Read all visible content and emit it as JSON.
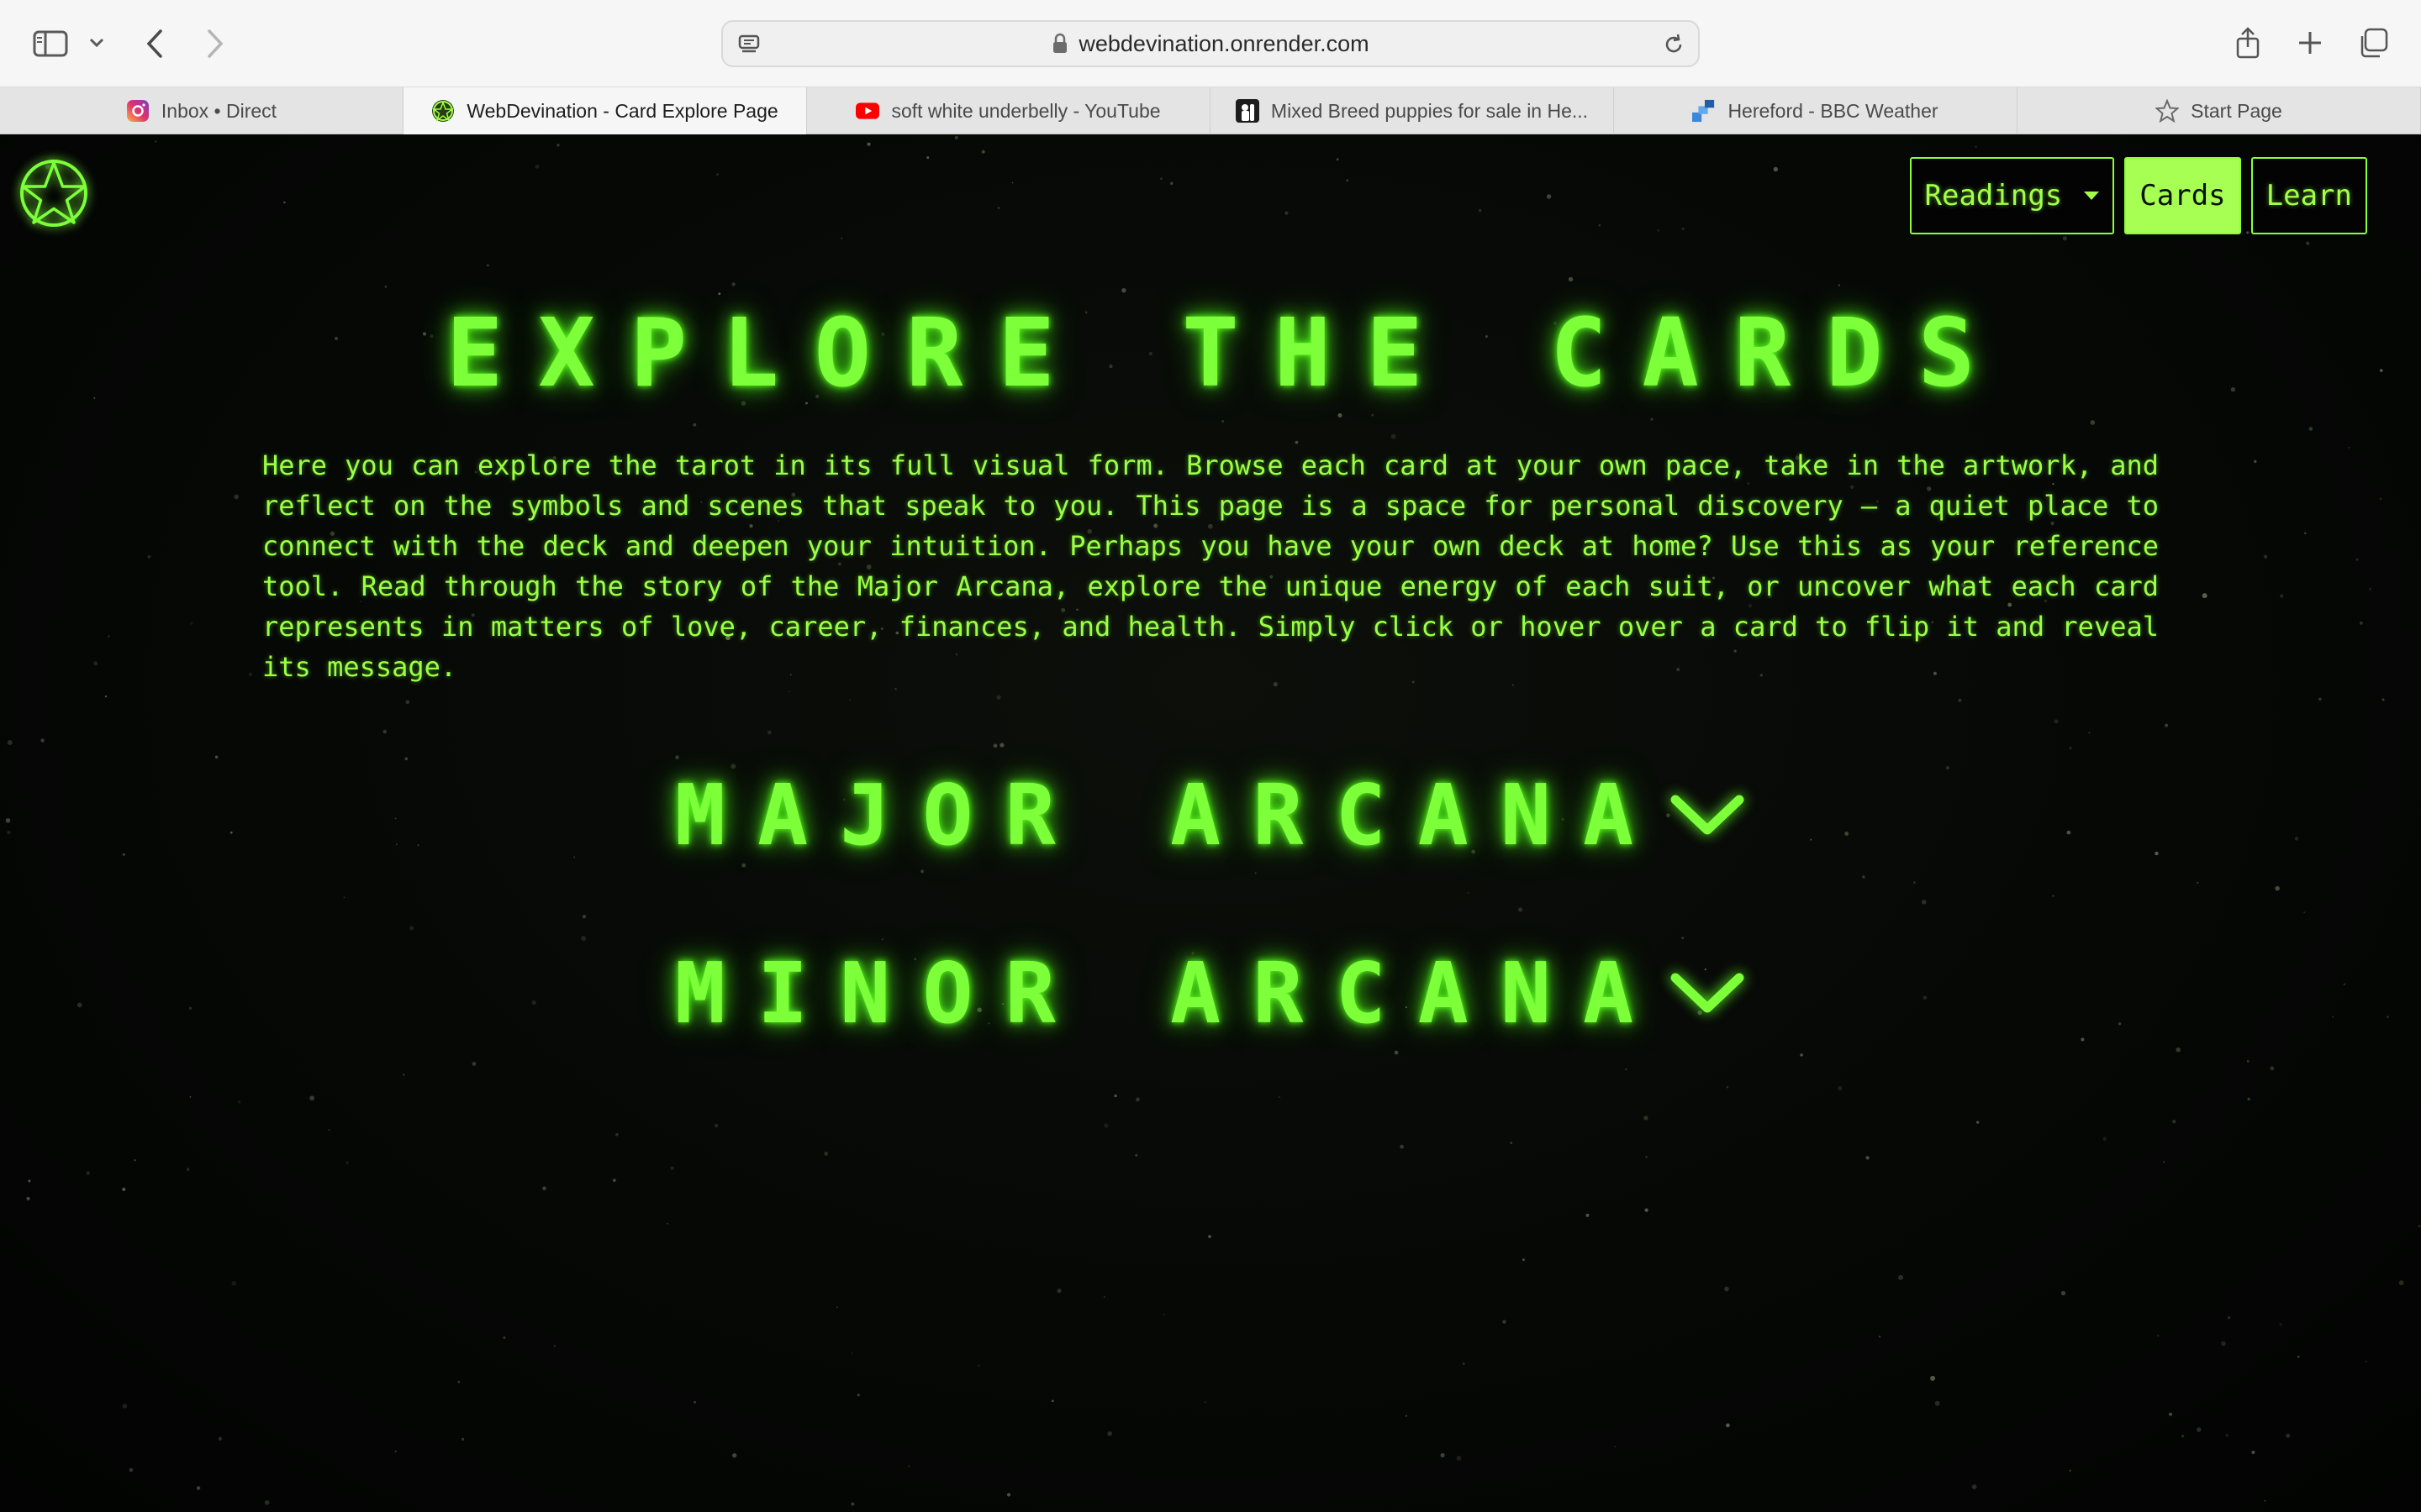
{
  "browser": {
    "url": "webdevination.onrender.com",
    "tabs": [
      {
        "label": "Inbox • Direct",
        "icon": "instagram-icon",
        "active": false
      },
      {
        "label": "WebDevination - Card Explore Page",
        "icon": "pentacle-favicon-icon",
        "active": true
      },
      {
        "label": "soft white underbelly - YouTube",
        "icon": "youtube-icon",
        "active": false
      },
      {
        "label": "Mixed Breed puppies for sale in He...",
        "icon": "puppy-site-icon",
        "active": false
      },
      {
        "label": "Hereford - BBC Weather",
        "icon": "bbc-weather-icon",
        "active": false
      },
      {
        "label": "Start Page",
        "icon": "star-icon",
        "active": false
      }
    ]
  },
  "nav": {
    "readings": "Readings",
    "cards": "Cards",
    "learn": "Learn"
  },
  "page": {
    "title": "EXPLORE THE CARDS",
    "intro": "Here you can explore the tarot in its full visual form. Browse each card at your own pace, take in the artwork, and reflect on the symbols and scenes that speak to you. This page is a space for personal discovery — a quiet place to connect with the deck and deepen your intuition. Perhaps you have your own deck at home? Use this as your reference tool. Read through the story of the Major Arcana, explore the unique energy of each suit, or uncover what each card represents in matters of love, career, finances, and health. Simply click or hover over a card to flip it and reveal its message.",
    "sections": [
      {
        "label": "MAJOR ARCANA",
        "icon": "chevron-down-icon"
      },
      {
        "label": "MINOR ARCANA",
        "icon": "chevron-down-icon"
      }
    ]
  },
  "colors": {
    "accent": "#7dff3a",
    "accent_light": "#a6ff52",
    "background": "#050605"
  }
}
